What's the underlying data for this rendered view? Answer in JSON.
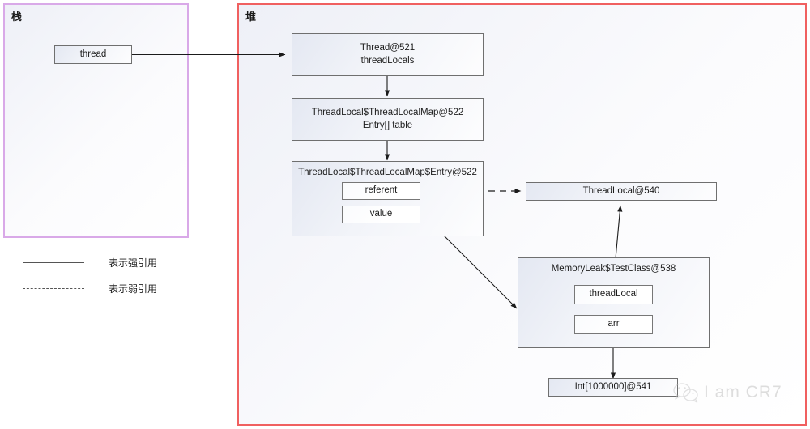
{
  "regions": {
    "stack": {
      "title": "栈",
      "border_color": "#d9a9e8"
    },
    "heap": {
      "title": "堆",
      "border_color": "#f06060"
    }
  },
  "stack_objects": {
    "thread": {
      "label": "thread"
    }
  },
  "heap_objects": {
    "thread_obj": {
      "line1": "Thread@521",
      "line2": "threadLocals"
    },
    "map_obj": {
      "line1": "ThreadLocal$ThreadLocalMap@522",
      "line2": "Entry[] table"
    },
    "entry_obj": {
      "title": "ThreadLocal$ThreadLocalMap$Entry@522",
      "fields": {
        "referent": "referent",
        "value": "value"
      }
    },
    "threadlocal_obj": {
      "label": "ThreadLocal@540"
    },
    "testclass_obj": {
      "title": "MemoryLeak$TestClass@538",
      "fields": {
        "threadLocal": "threadLocal",
        "arr": "arr"
      }
    },
    "array_obj": {
      "label": "Int[1000000]@541"
    }
  },
  "legend": {
    "strong": {
      "style": "solid",
      "label": "表示强引用"
    },
    "weak": {
      "style": "dashed",
      "label": "表示弱引用"
    }
  },
  "watermark": {
    "icon": "wechat-icon",
    "text": "I am CR7"
  },
  "edges": [
    {
      "from": "thread",
      "to": "thread_obj",
      "kind": "strong"
    },
    {
      "from": "thread_obj",
      "to": "map_obj",
      "kind": "strong"
    },
    {
      "from": "map_obj",
      "to": "entry_obj",
      "kind": "strong"
    },
    {
      "from": "referent",
      "to": "threadlocal_obj",
      "kind": "weak"
    },
    {
      "from": "value",
      "to": "testclass_obj",
      "kind": "strong"
    },
    {
      "from": "threadLocal",
      "to": "threadlocal_obj",
      "kind": "strong"
    },
    {
      "from": "arr",
      "to": "array_obj",
      "kind": "strong"
    }
  ]
}
